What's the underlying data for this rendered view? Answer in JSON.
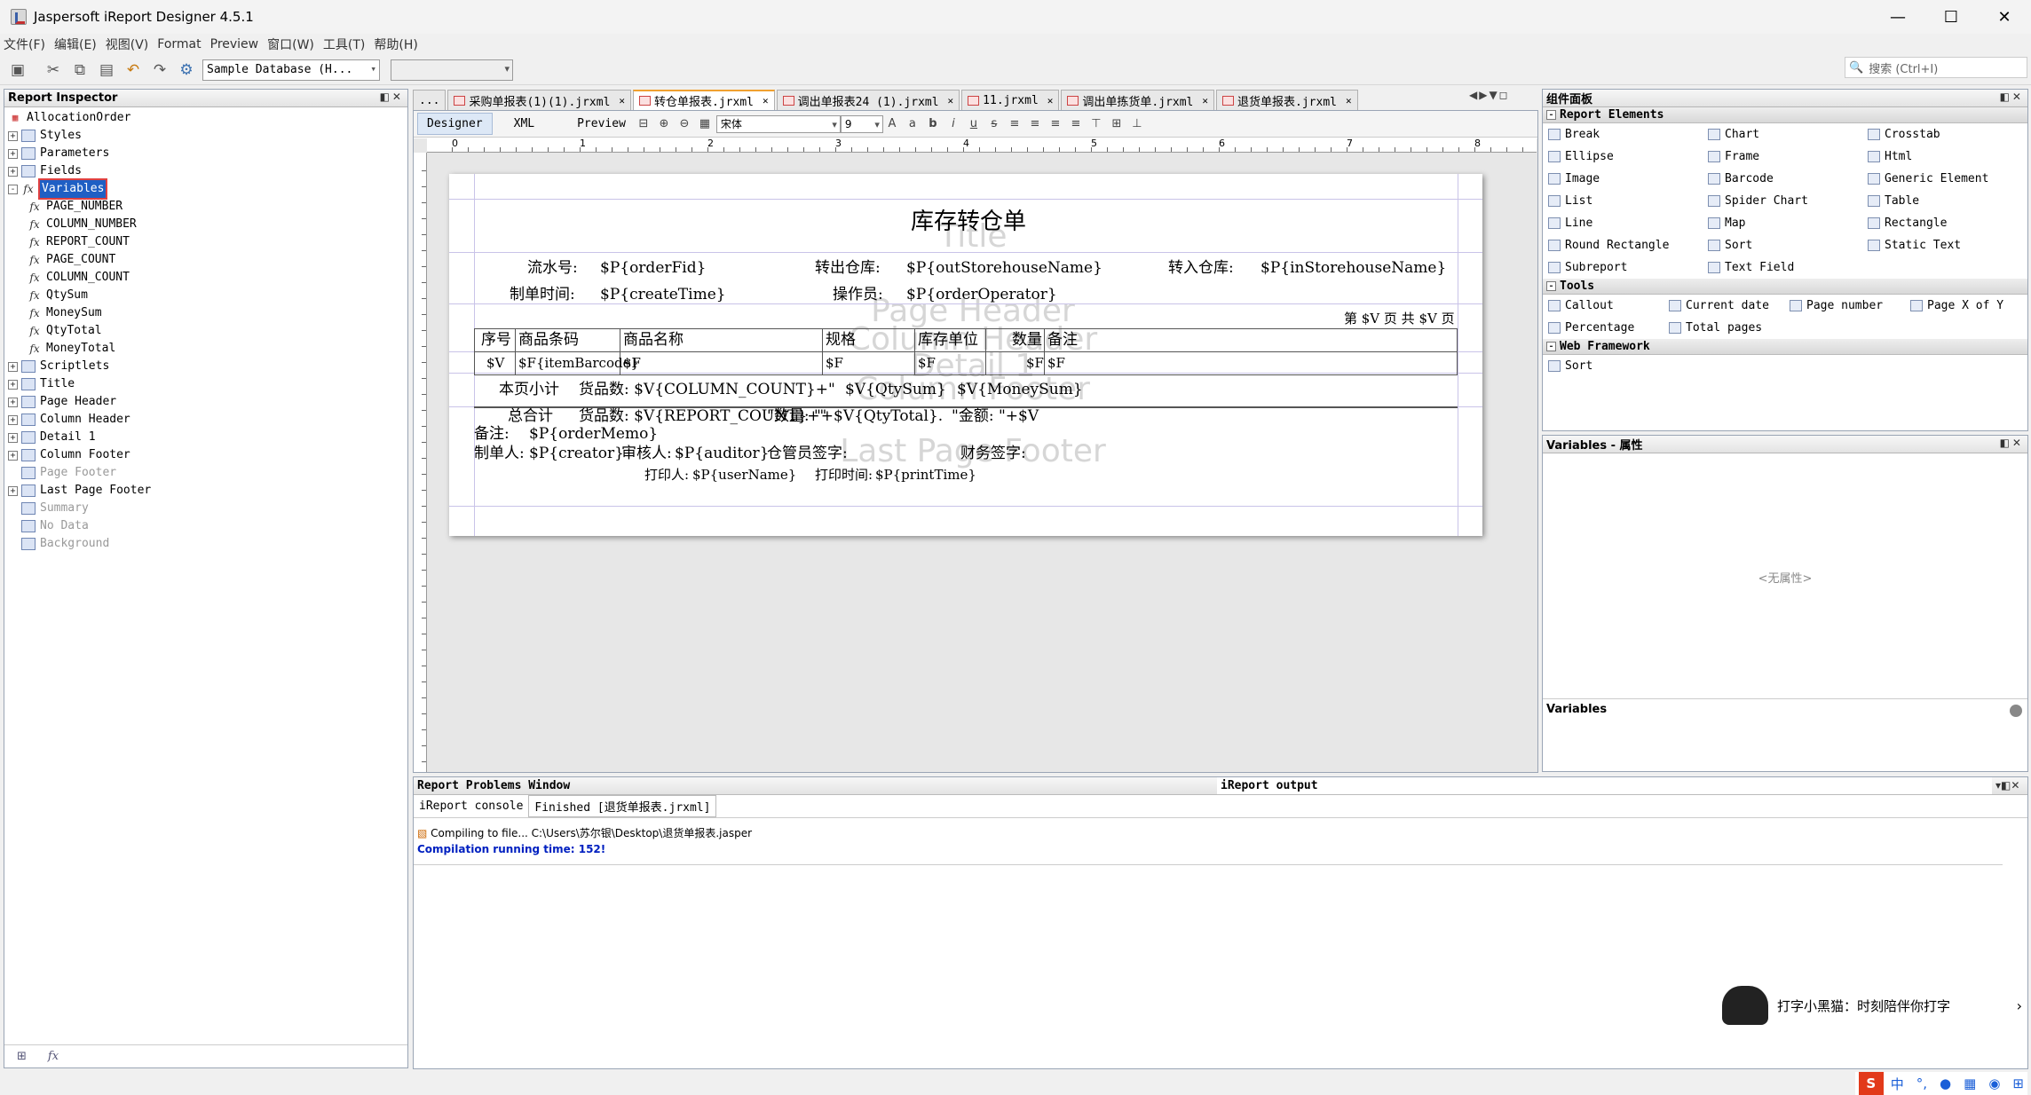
{
  "window": {
    "title": "Jaspersoft iReport Designer 4.5.1",
    "minimize": "—",
    "maximize": "☐",
    "close": "✕"
  },
  "menu": [
    "文件(F)",
    "编辑(E)",
    "视图(V)",
    "Format",
    "Preview",
    "窗口(W)",
    "工具(T)",
    "帮助(H)"
  ],
  "toolbar": {
    "datasource": "Sample Database (H...",
    "search_placeholder": "搜索 (Ctrl+I)"
  },
  "inspector": {
    "title": "Report Inspector",
    "root": "AllocationOrder",
    "nodes": [
      {
        "label": "Styles",
        "level": 0,
        "exp": "+"
      },
      {
        "label": "Parameters",
        "level": 0,
        "exp": "+"
      },
      {
        "label": "Fields",
        "level": 0,
        "exp": "+"
      },
      {
        "label": "Variables",
        "level": 0,
        "exp": "-",
        "selected": true
      },
      {
        "label": "PAGE_NUMBER",
        "level": 1
      },
      {
        "label": "COLUMN_NUMBER",
        "level": 1
      },
      {
        "label": "REPORT_COUNT",
        "level": 1
      },
      {
        "label": "PAGE_COUNT",
        "level": 1
      },
      {
        "label": "COLUMN_COUNT",
        "level": 1
      },
      {
        "label": "QtySum",
        "level": 1
      },
      {
        "label": "MoneySum",
        "level": 1
      },
      {
        "label": "QtyTotal",
        "level": 1
      },
      {
        "label": "MoneyTotal",
        "level": 1
      },
      {
        "label": "Scriptlets",
        "level": 0,
        "exp": "+"
      },
      {
        "label": "Title",
        "level": 0,
        "exp": "+"
      },
      {
        "label": "Page Header",
        "level": 0,
        "exp": "+"
      },
      {
        "label": "Column Header",
        "level": 0,
        "exp": "+"
      },
      {
        "label": "Detail 1",
        "level": 0,
        "exp": "+"
      },
      {
        "label": "Column Footer",
        "level": 0,
        "exp": "+"
      },
      {
        "label": "Page Footer",
        "level": 0,
        "grey": true
      },
      {
        "label": "Last Page Footer",
        "level": 0,
        "exp": "+"
      },
      {
        "label": "Summary",
        "level": 0,
        "grey": true
      },
      {
        "label": "No Data",
        "level": 0,
        "grey": true
      },
      {
        "label": "Background",
        "level": 0,
        "grey": true
      }
    ]
  },
  "tabs": [
    {
      "label": "...",
      "active": false
    },
    {
      "label": "采购单报表(1)(1).jrxml"
    },
    {
      "label": "转仓单报表.jrxml",
      "active": true
    },
    {
      "label": "调出单报表24 (1).jrxml"
    },
    {
      "label": "11.jrxml"
    },
    {
      "label": "调出单拣货单.jrxml"
    },
    {
      "label": "退货单报表.jrxml"
    }
  ],
  "editor": {
    "modes": [
      "Designer",
      "XML",
      "Preview"
    ],
    "font": "宋体",
    "size": "9"
  },
  "ruler": [
    "0",
    "1",
    "2",
    "3",
    "4",
    "5",
    "6",
    "7",
    "8"
  ],
  "report": {
    "title": "库存转仓单",
    "bands": {
      "title": "Title",
      "page_header": "Page Header",
      "column_header": "Column Header",
      "detail": "Detail 1",
      "column_footer": "Column Footer",
      "last_page_footer": "Last Page Footer"
    },
    "header1": {
      "l1": "流水号:",
      "v1": "$P{orderFid}",
      "l2": "转出仓库:",
      "v2": "$P{outStorehouseName}",
      "l3": "转入仓库:",
      "v3": "$P{inStorehouseName}"
    },
    "header2": {
      "l1": "制单时间:",
      "v1": "$P{createTime}",
      "l2": "操作员:",
      "v2": "$P{orderOperator}"
    },
    "pageinfo": "第 $V 页  共 $V 页",
    "columns": [
      "序号",
      "商品条码",
      "商品名称",
      "规格",
      "库存单位",
      "数量",
      "备注"
    ],
    "detail": [
      "$V",
      "$F{itemBarcode}",
      "$F",
      "$F",
      "$F",
      "$F",
      "$F"
    ],
    "subtotal": {
      "label": "本页小计",
      "count": "货品数: $V{COLUMN_COUNT}+\"",
      "qty": "$V{QtySum}",
      "money": "$V{MoneySum}"
    },
    "total": {
      "label": "总合计",
      "count": "货品数: $V{REPORT_COUNT}+\"",
      "qty": "\"数量: \"+$V{QtyTotal}.",
      "money": "\"金额: \"+$V"
    },
    "memo": {
      "label": "备注:",
      "value": "$P{orderMemo}"
    },
    "sign": {
      "l1": "制单人:",
      "v1": "$P{creator}",
      "l2": "审核人:",
      "v2": "$P{auditor}",
      "l3": "仓管员签字:",
      "l4": "财务签字:"
    },
    "print": {
      "l1": "打印人:",
      "v1": "$P{userName}",
      "l2": "打印时间:",
      "v2": "$P{printTime}"
    }
  },
  "palette": {
    "title": "组件面板",
    "sections": [
      {
        "name": "Report Elements",
        "items": [
          [
            "Break",
            "Chart",
            "Crosstab"
          ],
          [
            "Ellipse",
            "Frame",
            "Html"
          ],
          [
            "Image",
            "Barcode",
            "Generic Element"
          ],
          [
            "List",
            "Spider Chart",
            "Table"
          ],
          [
            "Line",
            "Map",
            "Rectangle"
          ],
          [
            "Round Rectangle",
            "Sort",
            "Static Text"
          ],
          [
            "Subreport",
            "Text Field",
            ""
          ]
        ]
      },
      {
        "name": "Tools",
        "items": [
          [
            "Callout",
            "Current date",
            "Page number",
            "Page X of Y"
          ],
          [
            "Percentage",
            "Total pages",
            "",
            ""
          ]
        ]
      },
      {
        "name": "Web Framework",
        "items": [
          [
            "Sort",
            "",
            ""
          ]
        ]
      }
    ]
  },
  "properties": {
    "title": "Variables - 属性",
    "empty": "<无属性>",
    "footer": "Variables"
  },
  "bottom": {
    "problems": "Report Problems Window",
    "output": "iReport output",
    "subtabs": [
      "iReport console",
      "Finished [退货单报表.jrxml]"
    ],
    "lines": [
      "Compiling to file... C:\\Users\\苏尔银\\Desktop\\退货单报表.jasper",
      "Compilation running time: 152!"
    ]
  },
  "ime": {
    "text": "打字小黑猫：时刻陪伴你打字",
    "lang": "中"
  }
}
